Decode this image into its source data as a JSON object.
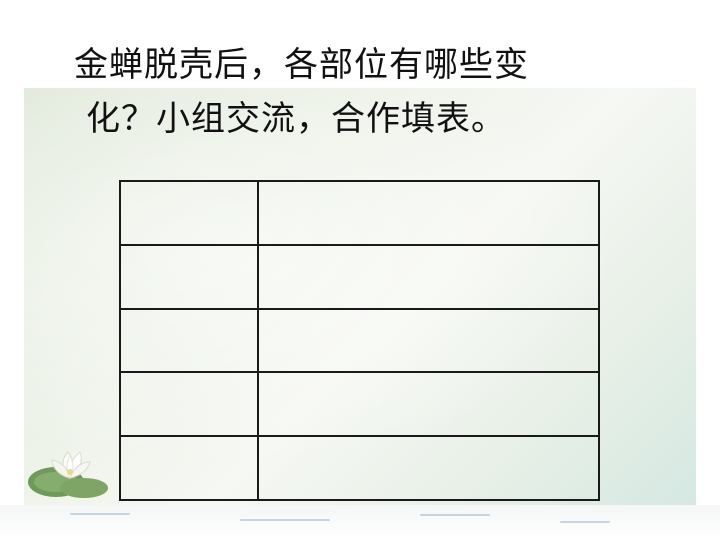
{
  "slide": {
    "title_line_1": "金蝉脱壳后，各部位有哪些变",
    "title_line_2": "化？小组交流，合作填表。"
  },
  "table": {
    "rows": [
      {
        "label": "",
        "content": ""
      },
      {
        "label": "",
        "content": ""
      },
      {
        "label": "",
        "content": ""
      },
      {
        "label": "",
        "content": ""
      },
      {
        "label": "",
        "content": ""
      }
    ]
  },
  "decoration": {
    "corner_image": "lotus-flower-icon"
  },
  "colors": {
    "background": "#eef3ea",
    "text": "#111111",
    "table_border": "#1a1a1a"
  }
}
